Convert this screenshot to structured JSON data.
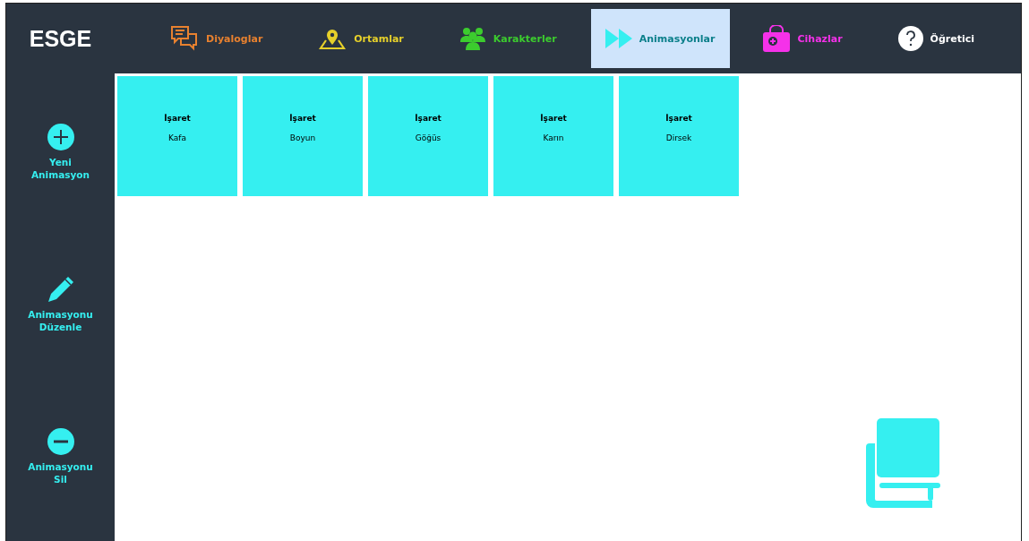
{
  "app": {
    "title": "ESGE"
  },
  "tabs": [
    {
      "label": "Diyaloglar",
      "kind": "dialog",
      "color": "#e8812f",
      "selected": false
    },
    {
      "label": "Ortamlar",
      "kind": "map",
      "color": "#e6d02a",
      "selected": false
    },
    {
      "label": "Karakterler",
      "kind": "people",
      "color": "#3ccc2e",
      "selected": false
    },
    {
      "label": "Animasyonlar",
      "kind": "forward",
      "color": "#35eff0",
      "selected": true
    },
    {
      "label": "Cihazlar",
      "kind": "kit",
      "color": "#f531e9",
      "selected": false
    },
    {
      "label": "Öğretici",
      "kind": "help",
      "color": "#ffffff",
      "selected": false
    }
  ],
  "sidebar": {
    "items": [
      {
        "label": "Yeni Animasyon",
        "kind": "add"
      },
      {
        "label": "Animasyonu Düzenle",
        "kind": "edit"
      },
      {
        "label": "Animasyonu Sil",
        "kind": "remove"
      }
    ]
  },
  "cards": [
    {
      "title": "İşaret",
      "subtitle": "Kafa"
    },
    {
      "title": "İşaret",
      "subtitle": "Boyun"
    },
    {
      "title": "İşaret",
      "subtitle": "Göğüs"
    },
    {
      "title": "İşaret",
      "subtitle": "Karın"
    },
    {
      "title": "İşaret",
      "subtitle": "Dirsek"
    }
  ]
}
